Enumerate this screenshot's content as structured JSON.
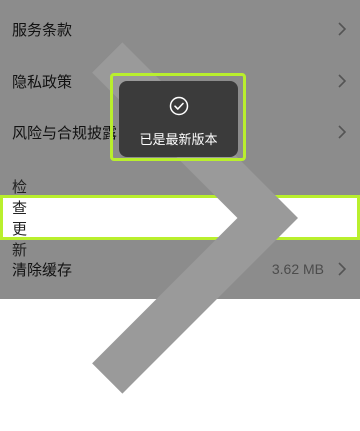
{
  "settings": {
    "items": [
      {
        "label": "服务条款",
        "value": ""
      },
      {
        "label": "隐私政策",
        "value": ""
      },
      {
        "label": "风险与合规披露",
        "value": ""
      },
      {
        "label": "检查更新",
        "value": ""
      },
      {
        "label": "清除缓存",
        "value": "3.62 MB"
      }
    ]
  },
  "toast": {
    "message": "已是最新版本",
    "icon": "check-circle-icon"
  },
  "colors": {
    "highlight": "#b9ef2d",
    "toast_bg": "#3b3b3b",
    "overlay": "rgba(0,0,0,0.45)"
  }
}
